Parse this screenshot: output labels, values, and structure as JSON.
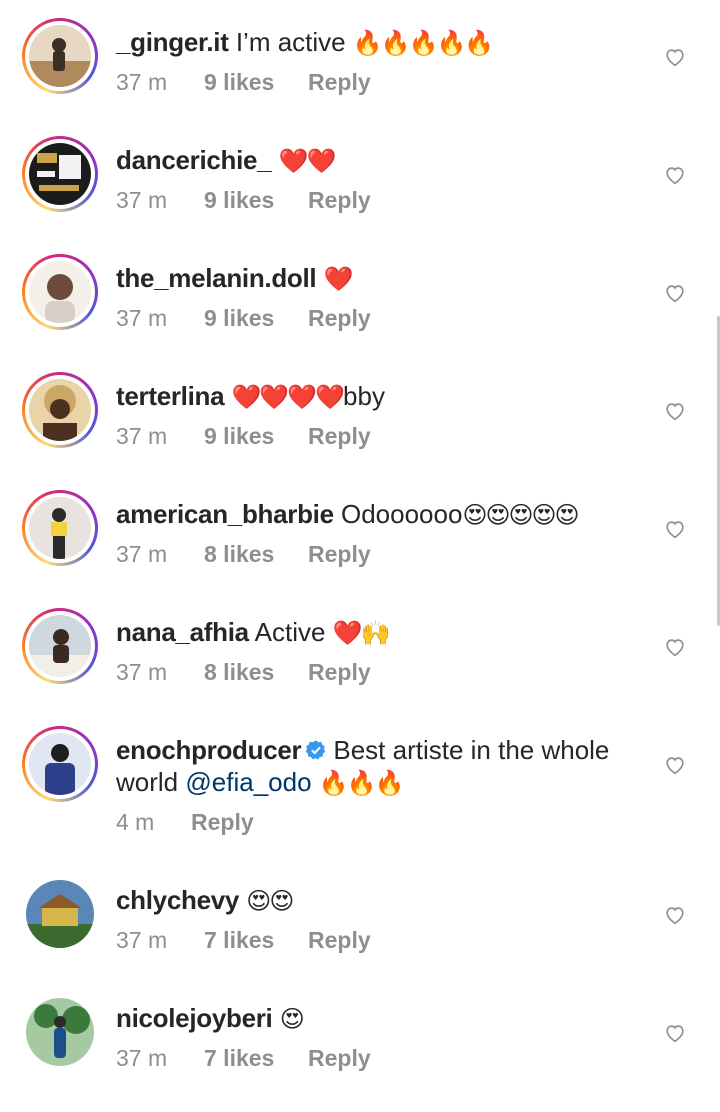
{
  "comments": [
    {
      "username": "_ginger.it",
      "text": "I’m active",
      "emoji": "🔥🔥🔥🔥🔥",
      "time": "37 m",
      "likes": "9 likes",
      "reply": "Reply",
      "avatar_colors": [
        "#b08a5c",
        "#3b2e26",
        "#e8d7c2"
      ]
    },
    {
      "username": "dancerichie_",
      "text": "",
      "emoji": "❤️❤️",
      "time": "37 m",
      "likes": "9 likes",
      "reply": "Reply",
      "avatar_colors": [
        "#1b1b1b",
        "#c9a24a",
        "#f2f2f2"
      ]
    },
    {
      "username": "the_melanin.doll",
      "text": "",
      "emoji": "❤️",
      "time": "37 m",
      "likes": "9 likes",
      "reply": "Reply",
      "avatar_colors": [
        "#d9cfc8",
        "#6b4b3a",
        "#f4efe9"
      ]
    },
    {
      "username": "terterlina",
      "text": "",
      "emoji": "❤️❤️❤️❤️",
      "text_after": "bby",
      "time": "37 m",
      "likes": "9 likes",
      "reply": "Reply",
      "avatar_colors": [
        "#caa766",
        "#4b3020",
        "#e9d3a8"
      ]
    },
    {
      "username": "american_bharbie",
      "text": "Odoooooo",
      "emoji": "😍😍😍😍😍",
      "time": "37 m",
      "likes": "8 likes",
      "reply": "Reply",
      "avatar_colors": [
        "#e8e3df",
        "#2b2b2b",
        "#f3d23c"
      ]
    },
    {
      "username": "nana_afhia",
      "text": "Active",
      "emoji": "❤️🙌",
      "time": "37 m",
      "likes": "8 likes",
      "reply": "Reply",
      "avatar_colors": [
        "#cfd8de",
        "#3a2a22",
        "#f2efe9"
      ]
    },
    {
      "username": "enochproducer",
      "verified": true,
      "text": "Best artiste in the whole world",
      "mention": "@efia_odo",
      "emoji": "🔥🔥🔥",
      "time": "4 m",
      "likes": "",
      "reply": "Reply",
      "avatar_colors": [
        "#2d3e8a",
        "#1f1f1f",
        "#e0e6f2"
      ]
    },
    {
      "username": "chlychevy",
      "text": "",
      "emoji": "😍😍",
      "time": "37 m",
      "likes": "7 likes",
      "reply": "Reply",
      "avatar_colors": [
        "#5a86b8",
        "#d6b64a",
        "#3c6b2f"
      ]
    },
    {
      "username": "nicolejoyberi",
      "text": "",
      "emoji": "😍",
      "time": "37 m",
      "likes": "7 likes",
      "reply": "Reply",
      "avatar_colors": [
        "#3b7a3b",
        "#1f4d8a",
        "#a5c9a0"
      ]
    }
  ],
  "colors": {
    "text": "#262626",
    "meta": "#8e8e8e",
    "mention": "#00376b",
    "verified": "#3897f0"
  },
  "icons": {
    "like": "heart-outline-icon",
    "verified": "verified-badge-icon"
  }
}
